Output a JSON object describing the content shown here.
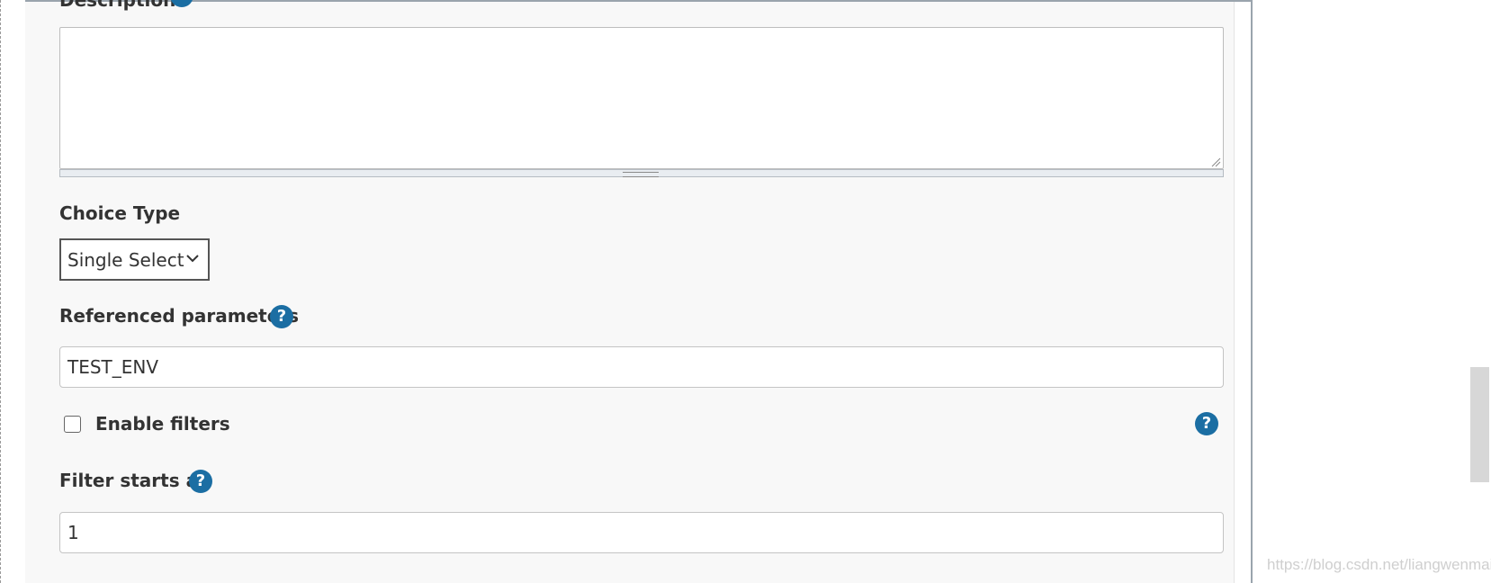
{
  "description": {
    "label": "Description",
    "help_icon": "question-circle-icon",
    "value": ""
  },
  "choice_type": {
    "label": "Choice Type",
    "selected": "Single Select",
    "chevron_icon": "chevron-down-icon"
  },
  "referenced_parameters": {
    "label": "Referenced parameters",
    "help_icon": "question-circle-icon",
    "value": "TEST_ENV"
  },
  "enable_filters": {
    "label": "Enable filters",
    "checked": false,
    "help_icon": "question-circle-icon"
  },
  "filter_starts_at": {
    "label": "Filter starts at",
    "help_icon": "question-circle-icon",
    "value": "1"
  },
  "help_glyph": "?",
  "watermark": "https://blog.csdn.net/liangwenmail",
  "colors": {
    "help_icon_bg": "#1b6ea3",
    "panel_bg": "#f8f8f8",
    "border": "#c4c4c4"
  }
}
